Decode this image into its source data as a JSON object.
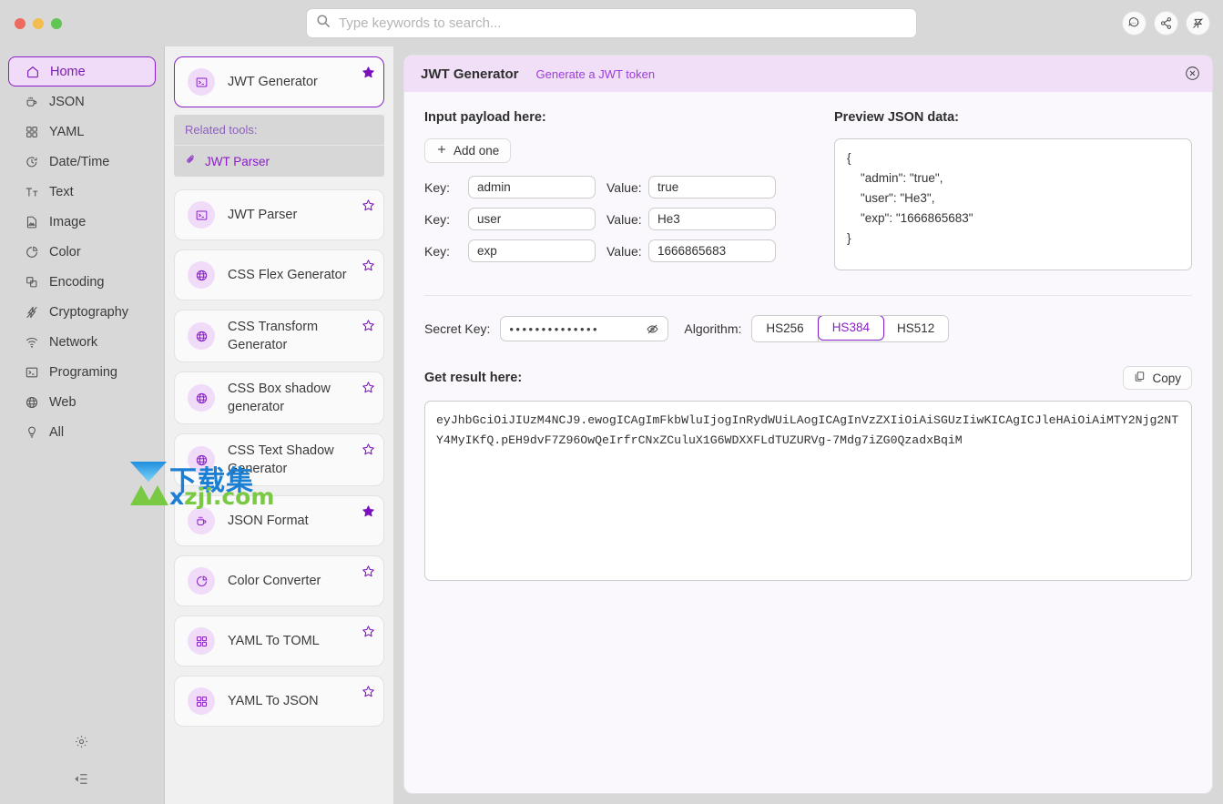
{
  "window": {
    "traffic_lights": [
      "close",
      "minimize",
      "maximize"
    ]
  },
  "search": {
    "placeholder": "Type keywords to search...",
    "value": "",
    "icon": "search-icon"
  },
  "top_actions": [
    {
      "name": "feedback-icon",
      "label": "Feedback"
    },
    {
      "name": "share-icon",
      "label": "Share"
    },
    {
      "name": "pin-icon",
      "label": "Pin"
    }
  ],
  "sidebar": {
    "items": [
      {
        "label": "Home",
        "icon": "home-icon",
        "active": true
      },
      {
        "label": "JSON",
        "icon": "coffee-icon",
        "active": false
      },
      {
        "label": "YAML",
        "icon": "grid-icon",
        "active": false
      },
      {
        "label": "Date/Time",
        "icon": "clock-icon",
        "active": false
      },
      {
        "label": "Text",
        "icon": "text-size-icon",
        "active": false
      },
      {
        "label": "Image",
        "icon": "image-file-icon",
        "active": false
      },
      {
        "label": "Color",
        "icon": "pie-chart-icon",
        "active": false
      },
      {
        "label": "Encoding",
        "icon": "copy-layers-icon",
        "active": false
      },
      {
        "label": "Cryptography",
        "icon": "lightning-icon",
        "active": false
      },
      {
        "label": "Network",
        "icon": "wifi-icon",
        "active": false
      },
      {
        "label": "Programing",
        "icon": "terminal-icon",
        "active": false
      },
      {
        "label": "Web",
        "icon": "globe-icon",
        "active": false
      },
      {
        "label": "All",
        "icon": "bulb-icon",
        "active": false
      }
    ],
    "bottom": [
      {
        "name": "settings-icon",
        "label": "Settings"
      },
      {
        "name": "collapse-sidebar-icon",
        "label": "Collapse"
      }
    ]
  },
  "tools": {
    "cards": [
      {
        "label": "JWT Generator",
        "icon": "terminal-icon",
        "starred": true,
        "selected": true
      },
      {
        "label": "JWT Parser",
        "icon": "terminal-icon",
        "starred": false,
        "selected": false
      },
      {
        "label": "CSS Flex Generator",
        "icon": "globe-icon",
        "starred": false,
        "selected": false
      },
      {
        "label": "CSS Transform Generator",
        "icon": "globe-icon",
        "starred": false,
        "selected": false
      },
      {
        "label": "CSS Box shadow generator",
        "icon": "globe-icon",
        "starred": false,
        "selected": false
      },
      {
        "label": "CSS Text Shadow Generator",
        "icon": "globe-icon",
        "starred": false,
        "selected": false
      },
      {
        "label": "JSON Format",
        "icon": "coffee-icon",
        "starred": true,
        "selected": false
      },
      {
        "label": "Color Converter",
        "icon": "pie-chart-icon",
        "starred": false,
        "selected": false
      },
      {
        "label": "YAML To TOML",
        "icon": "grid-icon",
        "starred": false,
        "selected": false
      },
      {
        "label": "YAML To JSON",
        "icon": "grid-icon",
        "starred": false,
        "selected": false
      }
    ],
    "related": {
      "heading": "Related tools:",
      "items": [
        {
          "label": "JWT Parser",
          "icon": "paperclip-icon"
        }
      ]
    }
  },
  "panel": {
    "title": "JWT Generator",
    "subtitle": "Generate a JWT token",
    "close_icon": "close-circle-icon",
    "payload": {
      "heading": "Input payload here:",
      "add_button": "Add one",
      "add_icon": "plus-icon",
      "key_label": "Key:",
      "value_label": "Value:",
      "rows": [
        {
          "key": "admin",
          "value": "true"
        },
        {
          "key": "user",
          "value": "He3"
        },
        {
          "key": "exp",
          "value": "1666865683"
        }
      ]
    },
    "preview": {
      "heading": "Preview JSON data:",
      "json": "{\n    \"admin\": \"true\",\n    \"user\": \"He3\",\n    \"exp\": \"1666865683\"\n}"
    },
    "secret": {
      "label": "Secret Key:",
      "masked_value": "••••••••••••••",
      "toggle_icon": "eye-off-icon"
    },
    "algorithm": {
      "label": "Algorithm:",
      "options": [
        "HS256",
        "HS384",
        "HS512"
      ],
      "selected": "HS384"
    },
    "result": {
      "heading": "Get result here:",
      "copy_label": "Copy",
      "copy_icon": "copy-icon",
      "token": "eyJhbGciOiJIUzM4NCJ9.ewogICAgImFkbWluIjogInRydWUiLAogICAgInVzZXIiOiAiSGUzIiwKICAgICJleHAiOiAiMTY2Njg2NTY4MyIKfQ.pEH9dvF7Z96OwQeIrfrCNxZCuluX1G6WDXXFLdTUZURVg-7Mdg7iZG0QzadxBqiM"
    }
  },
  "watermark": {
    "cn": "下载集",
    "en_x": "x",
    "en_z": "z",
    "en_rest": "ji.com"
  },
  "colors": {
    "accent": "#8a1ec8",
    "accent_light": "#f0dcf8",
    "header_bg": "#f1dff7",
    "panel_bg": "#faf8fc"
  }
}
